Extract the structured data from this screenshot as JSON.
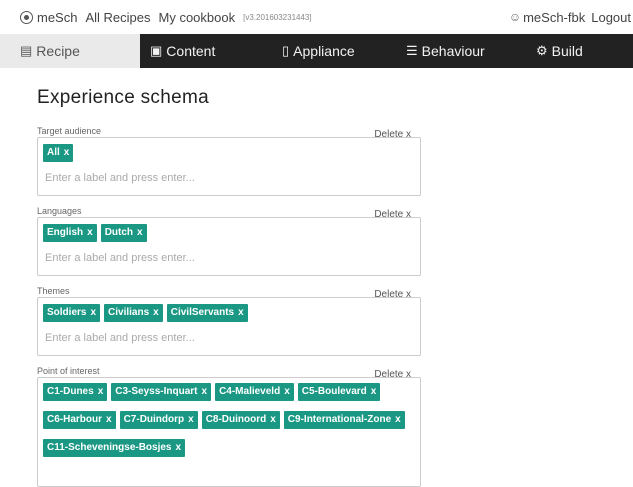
{
  "topbar": {
    "brand": "meSch",
    "links": [
      "All Recipes",
      "My cookbook"
    ],
    "version": "[v3.201603231443]",
    "user": "meSch-fbk",
    "logout": "Logout"
  },
  "nav": {
    "tabs": [
      {
        "label": "Recipe",
        "icon": "document-icon",
        "active": true
      },
      {
        "label": "Content",
        "icon": "monitor-icon",
        "active": false
      },
      {
        "label": "Appliance",
        "icon": "device-icon",
        "active": false
      },
      {
        "label": "Behaviour",
        "icon": "list-icon",
        "active": false
      },
      {
        "label": "Build",
        "icon": "gear-icon",
        "active": false
      }
    ]
  },
  "main": {
    "title": "Experience schema",
    "delete_label": "Delete x",
    "input_placeholder": "Enter a label and press enter...",
    "tag_remove": "x",
    "sections": [
      {
        "label": "Target audience",
        "tags": [
          "All"
        ]
      },
      {
        "label": "Languages",
        "tags": [
          "English",
          "Dutch"
        ]
      },
      {
        "label": "Themes",
        "tags": [
          "Soldiers",
          "Civilians",
          "CivilServants"
        ]
      },
      {
        "label": "Point of interest",
        "tags": [
          "C1-Dunes",
          "C3-Seyss-Inquart",
          "C4-Malieveld",
          "C5-Boulevard",
          "C6-Harbour",
          "C7-Duindorp",
          "C8-Duinoord",
          "C9-International-Zone",
          "C11-Scheveningse-Bosjes"
        ]
      }
    ]
  },
  "colors": {
    "tag_bg": "#1a9884",
    "navbar_bg": "#222222",
    "active_tab_bg": "#eaeaea"
  }
}
